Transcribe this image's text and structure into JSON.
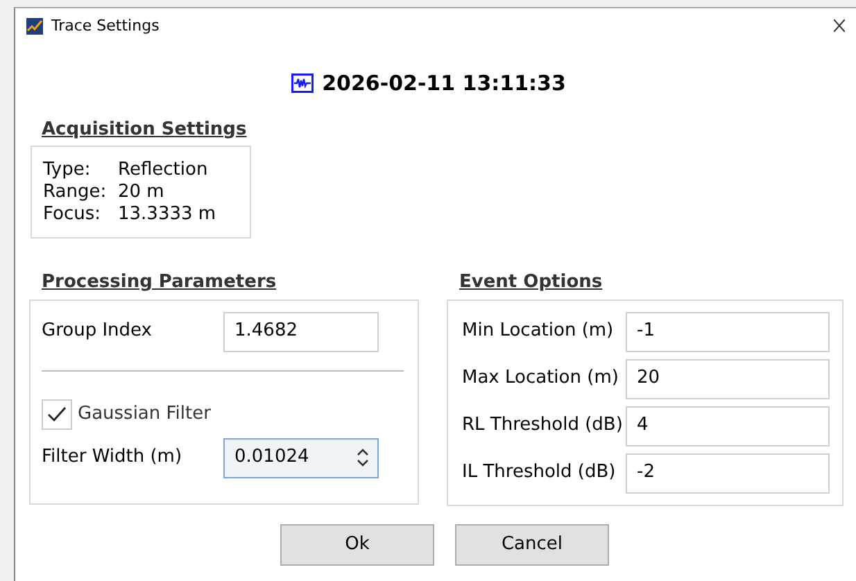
{
  "window": {
    "title": "Trace Settings"
  },
  "timestamp": "2026-02-11 13:11:33",
  "acquisition": {
    "heading": "Acquisition Settings",
    "rows": [
      {
        "label": "Type:",
        "value": "Reflection"
      },
      {
        "label": "Range:",
        "value": "20 m"
      },
      {
        "label": "Focus:",
        "value": "13.3333 m"
      }
    ]
  },
  "processing": {
    "heading": "Processing Parameters",
    "group_index": {
      "label": "Group Index",
      "value": "1.4682"
    },
    "gaussian_filter": {
      "label": "Gaussian Filter",
      "checked": true
    },
    "filter_width": {
      "label": "Filter Width (m)",
      "value": "0.01024"
    }
  },
  "events": {
    "heading": "Event Options",
    "fields": [
      {
        "label": "Min Location (m)",
        "value": "-1"
      },
      {
        "label": "Max Location (m)",
        "value": "20"
      },
      {
        "label": "RL Threshold (dB)",
        "value": "4"
      },
      {
        "label": "IL Threshold (dB)",
        "value": "-2"
      }
    ]
  },
  "buttons": [
    "Ok",
    "Cancel"
  ]
}
